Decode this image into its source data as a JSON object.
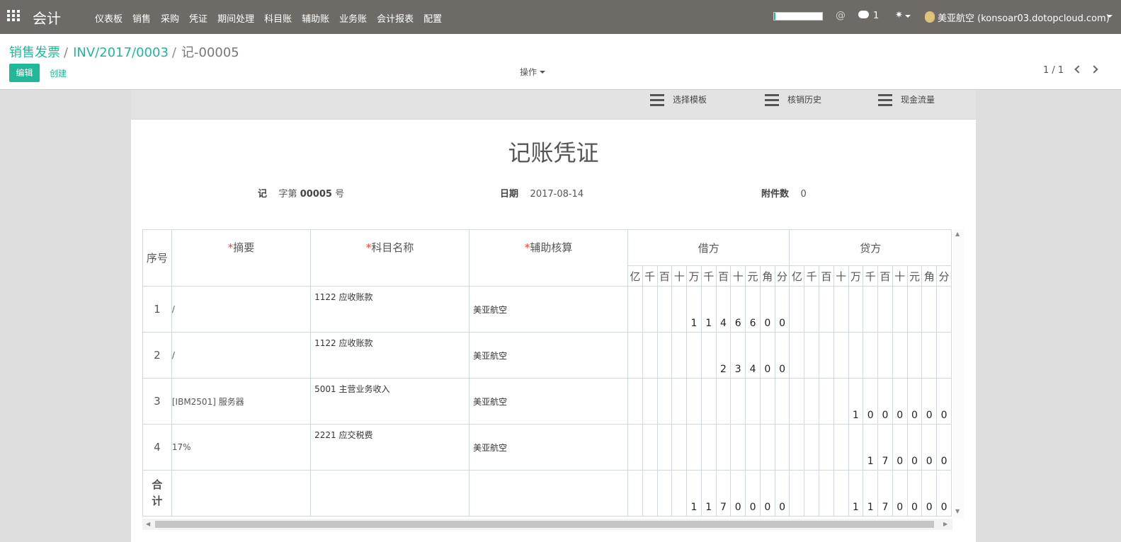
{
  "topbar": {
    "app_title": "会计",
    "menu": [
      "仪表板",
      "销售",
      "采购",
      "凭证",
      "期间处理",
      "科目账",
      "辅助账",
      "业务账",
      "会计报表",
      "配置"
    ],
    "progress_pct": 3,
    "at_icon": "@",
    "chat_icon": "chat-icon",
    "chat_count": "1",
    "bug_icon": "✷",
    "user": "美亚航空 (konsoar03.dotopcloud.com)"
  },
  "breadcrumb": {
    "item1": "销售发票",
    "item2": "INV/2017/0003",
    "sep": "/",
    "current": "记-00005"
  },
  "buttons": {
    "edit": "编辑",
    "create": "创建",
    "actions": "操作"
  },
  "pager": {
    "value": "1 / 1"
  },
  "toolbar": {
    "template": "选择模板",
    "history": "核销历史",
    "cashflow": "现金流量"
  },
  "voucher": {
    "title": "记账凭证",
    "prefix": "记",
    "word": "字第",
    "number": "00005",
    "number_suffix": "号",
    "date_label": "日期",
    "date": "2017-08-14",
    "attach_label": "附件数",
    "attach_count": "0"
  },
  "table": {
    "seq_header": "序号",
    "summary_header": "摘要",
    "account_header": "科目名称",
    "aux_header": "辅助核算",
    "debit_header": "借方",
    "credit_header": "贷方",
    "required_mark": "*",
    "digit_units": [
      "亿",
      "千",
      "百",
      "十",
      "万",
      "千",
      "百",
      "十",
      "元",
      "角",
      "分"
    ],
    "rows": [
      {
        "seq": "1",
        "summary": "/",
        "account": "1122 应收账款",
        "aux": "美亚航空",
        "debit": [
          "",
          "",
          "",
          "",
          "1",
          "1",
          "4",
          "6",
          "6",
          "0",
          "0"
        ],
        "credit": [
          "",
          "",
          "",
          "",
          "",
          "",
          "",
          "",
          "",
          "",
          ""
        ]
      },
      {
        "seq": "2",
        "summary": "/",
        "account": "1122 应收账款",
        "aux": "美亚航空",
        "debit": [
          "",
          "",
          "",
          "",
          "",
          "",
          "2",
          "3",
          "4",
          "0",
          "0"
        ],
        "credit": [
          "",
          "",
          "",
          "",
          "",
          "",
          "",
          "",
          "",
          "",
          ""
        ]
      },
      {
        "seq": "3",
        "summary": "[IBM2501] 服务器",
        "account": "5001 主营业务收入",
        "aux": "美亚航空",
        "debit": [
          "",
          "",
          "",
          "",
          "",
          "",
          "",
          "",
          "",
          "",
          ""
        ],
        "credit": [
          "",
          "",
          "",
          "",
          "1",
          "0",
          "0",
          "0",
          "0",
          "0",
          "0"
        ]
      },
      {
        "seq": "4",
        "summary": "17%",
        "account": "2221 应交税费",
        "aux": "美亚航空",
        "debit": [
          "",
          "",
          "",
          "",
          "",
          "",
          "",
          "",
          "",
          "",
          ""
        ],
        "credit": [
          "",
          "",
          "",
          "",
          "",
          "1",
          "7",
          "0",
          "0",
          "0",
          "0"
        ]
      }
    ],
    "total": {
      "label_1": "合",
      "label_2": "计",
      "debit": [
        "",
        "",
        "",
        "",
        "1",
        "1",
        "7",
        "0",
        "0",
        "0",
        "0"
      ],
      "credit": [
        "",
        "",
        "",
        "",
        "1",
        "1",
        "7",
        "0",
        "0",
        "0",
        "0"
      ]
    }
  }
}
